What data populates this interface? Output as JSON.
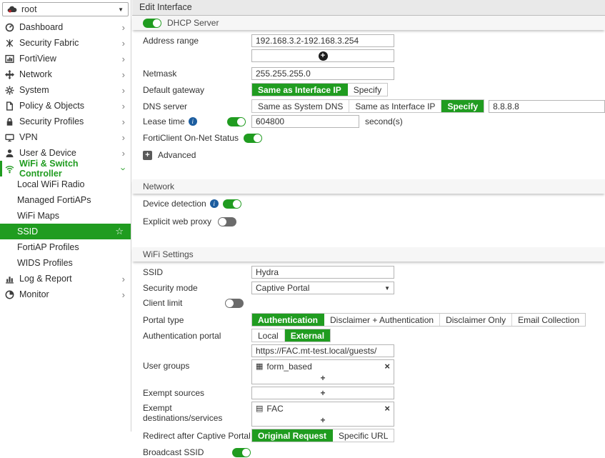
{
  "colors": {
    "accent_green": "#209c20",
    "info_blue": "#1c5d9f",
    "toggle_off_gray": "#6b6b6b"
  },
  "icons": {
    "caret_down": "▼",
    "chevron_right": "›",
    "star": "☆",
    "plus": "+",
    "close": "×",
    "info": "i",
    "user_group_glyph": "▦",
    "address_glyph": "▤"
  },
  "vdom": {
    "label": "root"
  },
  "sidebar": {
    "items": [
      {
        "label": "Dashboard",
        "icon": "gauge-icon"
      },
      {
        "label": "Security Fabric",
        "icon": "fabric-icon"
      },
      {
        "label": "FortiView",
        "icon": "fortiview-icon"
      },
      {
        "label": "Network",
        "icon": "network-icon"
      },
      {
        "label": "System",
        "icon": "gear-icon"
      },
      {
        "label": "Policy & Objects",
        "icon": "policy-icon"
      },
      {
        "label": "Security Profiles",
        "icon": "lock-icon"
      },
      {
        "label": "VPN",
        "icon": "vpn-icon"
      },
      {
        "label": "User & Device",
        "icon": "user-icon"
      },
      {
        "label": "WiFi & Switch Controller",
        "icon": "wifi-icon",
        "state": "expanded-active"
      },
      {
        "label": "Local WiFi Radio",
        "type": "sub"
      },
      {
        "label": "Managed FortiAPs",
        "type": "sub"
      },
      {
        "label": "WiFi Maps",
        "type": "sub"
      },
      {
        "label": "SSID",
        "type": "sub",
        "state": "selected"
      },
      {
        "label": "FortiAP Profiles",
        "type": "sub"
      },
      {
        "label": "WIDS Profiles",
        "type": "sub"
      },
      {
        "label": "Log & Report",
        "icon": "log-report-icon"
      },
      {
        "label": "Monitor",
        "icon": "monitor-icon"
      }
    ]
  },
  "header": {
    "title": "Edit Interface"
  },
  "dhcp": {
    "section_label": "DHCP Server",
    "enabled": "on",
    "address_range": {
      "label": "Address range",
      "value": "192.168.3.2-192.168.3.254"
    },
    "netmask": {
      "label": "Netmask",
      "value": "255.255.255.0"
    },
    "default_gateway": {
      "label": "Default gateway",
      "options": [
        "Same as Interface IP",
        "Specify"
      ],
      "selected": "Same as Interface IP"
    },
    "dns_server": {
      "label": "DNS server",
      "options": [
        "Same as System DNS",
        "Same as Interface IP",
        "Specify"
      ],
      "selected": "Specify",
      "value": "8.8.8.8"
    },
    "lease_time": {
      "label": "Lease time",
      "enabled": "on",
      "value": "604800",
      "unit": "second(s)"
    },
    "forticlient": {
      "label": "FortiClient On-Net Status",
      "enabled": "on"
    },
    "advanced_label": "Advanced"
  },
  "network": {
    "section_label": "Network",
    "device_detection": {
      "label": "Device detection",
      "enabled": "on"
    },
    "explicit_web_proxy": {
      "label": "Explicit web proxy",
      "enabled": "off"
    }
  },
  "wifi": {
    "section_label": "WiFi Settings",
    "ssid": {
      "label": "SSID",
      "value": "Hydra"
    },
    "security_mode": {
      "label": "Security mode",
      "value": "Captive Portal"
    },
    "client_limit": {
      "label": "Client limit",
      "enabled": "off"
    },
    "portal_type": {
      "label": "Portal type",
      "options": [
        "Authentication",
        "Disclaimer + Authentication",
        "Disclaimer Only",
        "Email Collection"
      ],
      "selected": "Authentication"
    },
    "auth_portal": {
      "label": "Authentication portal",
      "options": [
        "Local",
        "External"
      ],
      "selected": "External",
      "url": "https://FAC.mt-test.local/guests/"
    },
    "user_groups": {
      "label": "User groups",
      "items": [
        "form_based"
      ]
    },
    "exempt_sources": {
      "label": "Exempt sources"
    },
    "exempt_destinations": {
      "label": "Exempt destinations/services",
      "items": [
        "FAC"
      ]
    },
    "redirect": {
      "label": "Redirect after Captive Portal",
      "options": [
        "Original Request",
        "Specific URL"
      ],
      "selected": "Original Request"
    },
    "broadcast_ssid": {
      "label": "Broadcast SSID",
      "enabled": "on"
    }
  }
}
